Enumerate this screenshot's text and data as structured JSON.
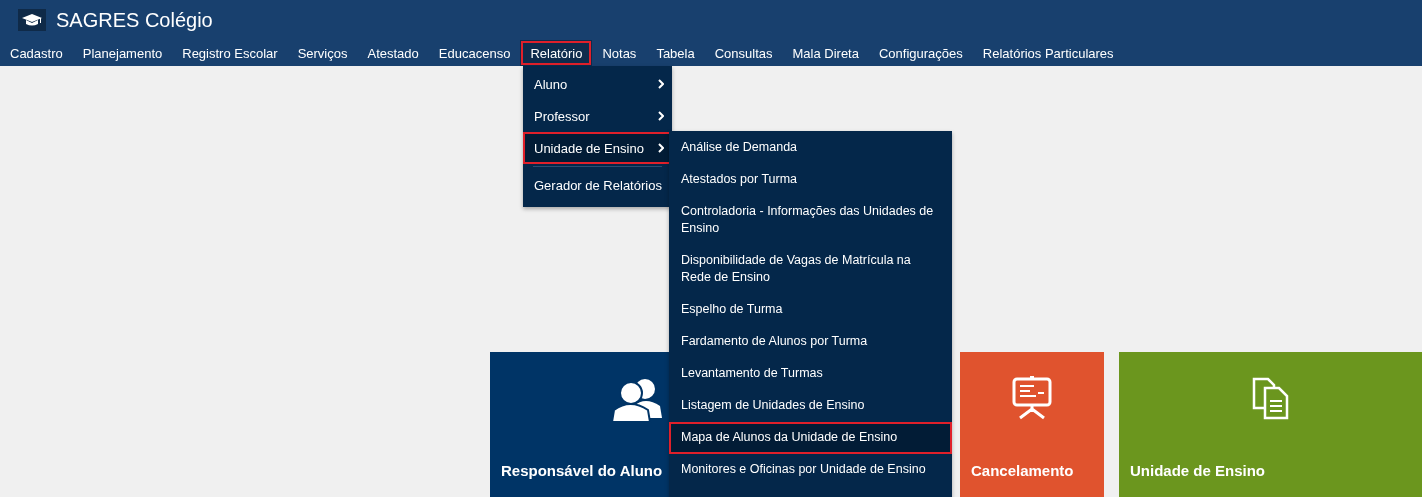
{
  "app": {
    "title": "SAGRES Colégio"
  },
  "nav": [
    {
      "label": "Cadastro",
      "selected": false,
      "highlighted": false
    },
    {
      "label": "Planejamento",
      "selected": false,
      "highlighted": false
    },
    {
      "label": "Registro Escolar",
      "selected": false,
      "highlighted": false
    },
    {
      "label": "Serviços",
      "selected": false,
      "highlighted": false
    },
    {
      "label": "Atestado",
      "selected": false,
      "highlighted": false
    },
    {
      "label": "Educacenso",
      "selected": false,
      "highlighted": false
    },
    {
      "label": "Relatório",
      "selected": true,
      "highlighted": true
    },
    {
      "label": "Notas",
      "selected": false,
      "highlighted": false
    },
    {
      "label": "Tabela",
      "selected": false,
      "highlighted": false
    },
    {
      "label": "Consultas",
      "selected": false,
      "highlighted": false
    },
    {
      "label": "Mala Direta",
      "selected": false,
      "highlighted": false
    },
    {
      "label": "Configurações",
      "selected": false,
      "highlighted": false
    },
    {
      "label": "Relatórios Particulares",
      "selected": false,
      "highlighted": false
    }
  ],
  "menu": [
    {
      "label": "Aluno",
      "has_submenu": true,
      "selected": false,
      "highlighted": false,
      "divider_before": false
    },
    {
      "label": "Professor",
      "has_submenu": true,
      "selected": false,
      "highlighted": false,
      "divider_before": false
    },
    {
      "label": "Unidade de Ensino",
      "has_submenu": true,
      "selected": true,
      "highlighted": true,
      "divider_before": false
    },
    {
      "label": "Gerador de Relatórios",
      "has_submenu": false,
      "selected": false,
      "highlighted": false,
      "divider_before": true
    }
  ],
  "submenu": [
    {
      "label": "Análise de Demanda",
      "selected": false,
      "highlighted": false
    },
    {
      "label": "Atestados por Turma",
      "selected": false,
      "highlighted": false
    },
    {
      "label": "Controladoria - Informações das Unidades de Ensino",
      "selected": false,
      "highlighted": false
    },
    {
      "label": "Disponibilidade de Vagas de Matrícula na Rede de Ensino",
      "selected": false,
      "highlighted": false
    },
    {
      "label": "Espelho de Turma",
      "selected": false,
      "highlighted": false
    },
    {
      "label": "Fardamento de Alunos por Turma",
      "selected": false,
      "highlighted": false
    },
    {
      "label": "Levantamento de Turmas",
      "selected": false,
      "highlighted": false
    },
    {
      "label": "Listagem de Unidades de Ensino",
      "selected": false,
      "highlighted": false
    },
    {
      "label": "Mapa de Alunos da Unidade de Ensino",
      "selected": true,
      "highlighted": true
    },
    {
      "label": "Monitores e Oficinas por Unidade de Ensino",
      "selected": false,
      "highlighted": false
    }
  ],
  "tiles": [
    {
      "label": "Responsável do Aluno",
      "color": "#003466",
      "kind": "people"
    },
    {
      "label": "Cancelamento",
      "color": "#e0532e",
      "kind": "presentation"
    },
    {
      "label": "Unidade de Ensino",
      "color": "#6b961e",
      "kind": "documents"
    }
  ]
}
